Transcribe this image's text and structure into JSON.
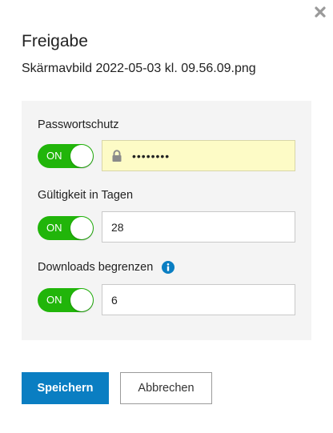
{
  "dialog": {
    "title": "Freigabe",
    "filename": "Skärmavbild 2022-05-03 kl. 09.56.09.png",
    "close_icon": "close-icon"
  },
  "password": {
    "label": "Passwortschutz",
    "toggle_text": "ON",
    "toggle_on": true,
    "value": "••••••••",
    "icon": "lock-icon"
  },
  "validity": {
    "label": "Gültigkeit in Tagen",
    "toggle_text": "ON",
    "toggle_on": true,
    "value": "28"
  },
  "downloads": {
    "label": "Downloads begrenzen",
    "toggle_text": "ON",
    "toggle_on": true,
    "value": "6",
    "icon": "info-icon"
  },
  "actions": {
    "save_label": "Speichern",
    "cancel_label": "Abbrechen"
  },
  "colors": {
    "accent": "#0a7ec2",
    "toggle_on": "#21b50a",
    "password_bg": "#fdfbc6",
    "panel_bg": "#f4f4f4"
  }
}
